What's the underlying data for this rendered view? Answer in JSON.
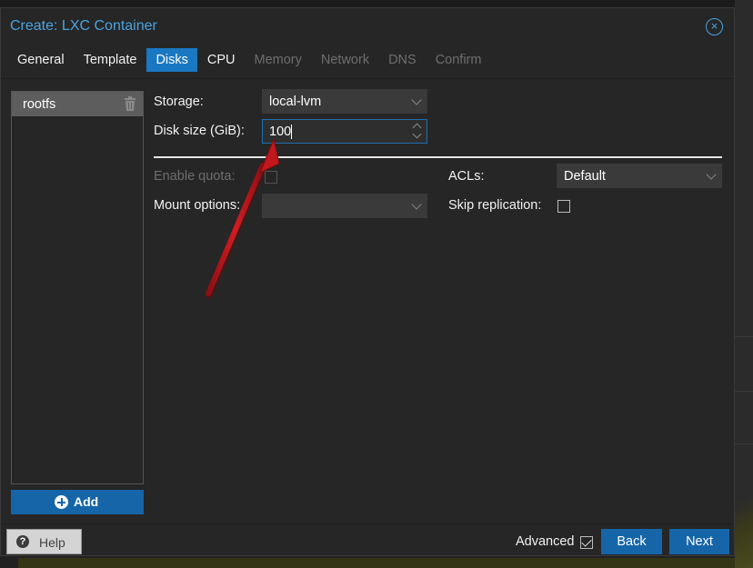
{
  "window": {
    "title": "Create: LXC Container",
    "close_icon": "×"
  },
  "tabs": [
    {
      "label": "General",
      "state": "normal"
    },
    {
      "label": "Template",
      "state": "normal"
    },
    {
      "label": "Disks",
      "state": "active"
    },
    {
      "label": "CPU",
      "state": "normal"
    },
    {
      "label": "Memory",
      "state": "disabled"
    },
    {
      "label": "Network",
      "state": "disabled"
    },
    {
      "label": "DNS",
      "state": "disabled"
    },
    {
      "label": "Confirm",
      "state": "disabled"
    }
  ],
  "disk_list": {
    "items": [
      {
        "label": "rootfs"
      }
    ],
    "add_label": "Add"
  },
  "form": {
    "storage": {
      "label": "Storage:",
      "value": "local-lvm"
    },
    "disk_size": {
      "label": "Disk size (GiB):",
      "value": "100"
    },
    "enable_quota": {
      "label": "Enable quota:",
      "checked": false
    },
    "mount_options": {
      "label": "Mount options:",
      "value": ""
    },
    "acls": {
      "label": "ACLs:",
      "value": "Default"
    },
    "skip_replication": {
      "label": "Skip replication:",
      "checked": false
    }
  },
  "footer": {
    "help_label": "Help",
    "help_icon": "?",
    "advanced_label": "Advanced",
    "advanced_checked": true,
    "back_label": "Back",
    "next_label": "Next"
  },
  "colors": {
    "accent": "#1a78c2",
    "title": "#4aa3e0",
    "annotation_arrow": "#c0181d"
  }
}
